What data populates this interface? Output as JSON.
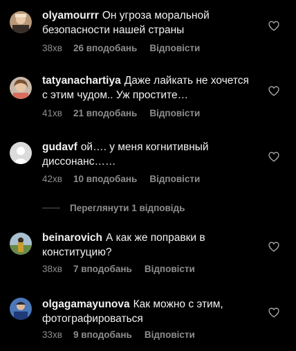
{
  "comments": [
    {
      "username": "olyamourrr",
      "text": "Он угроза моральной безопасности нашей страны",
      "time": "38хв",
      "likes": "26 вподобань",
      "reply": "Відповісти"
    },
    {
      "username": "tatyanachartiya",
      "text": "Даже лайкать не хочется с этим чудом.. Уж простите…",
      "time": "41хв",
      "likes": "21 вподобань",
      "reply": "Відповісти"
    },
    {
      "username": "gudavf",
      "text": "ой…. у меня когнитивный диссонанс……",
      "time": "42хв",
      "likes": "10 вподобань",
      "reply": "Відповісти"
    },
    {
      "username": "beinarovich",
      "text": "А как же поправки в конституцию?",
      "time": "38хв",
      "likes": "7 вподобань",
      "reply": "Відповісти"
    },
    {
      "username": "olgagamayunova",
      "text": "Как можно с этим, фотографироваться",
      "time": "33хв",
      "likes": "9 вподобань",
      "reply": "Відповісти"
    }
  ],
  "view_replies_label": "Переглянути 1 відповідь",
  "icons": {
    "like": "heart-outline-icon",
    "avatar_placeholder": "default-avatar-icon"
  },
  "colors": {
    "background": "#000000",
    "text": "#f2f2f2",
    "muted": "#8e8e8e"
  }
}
